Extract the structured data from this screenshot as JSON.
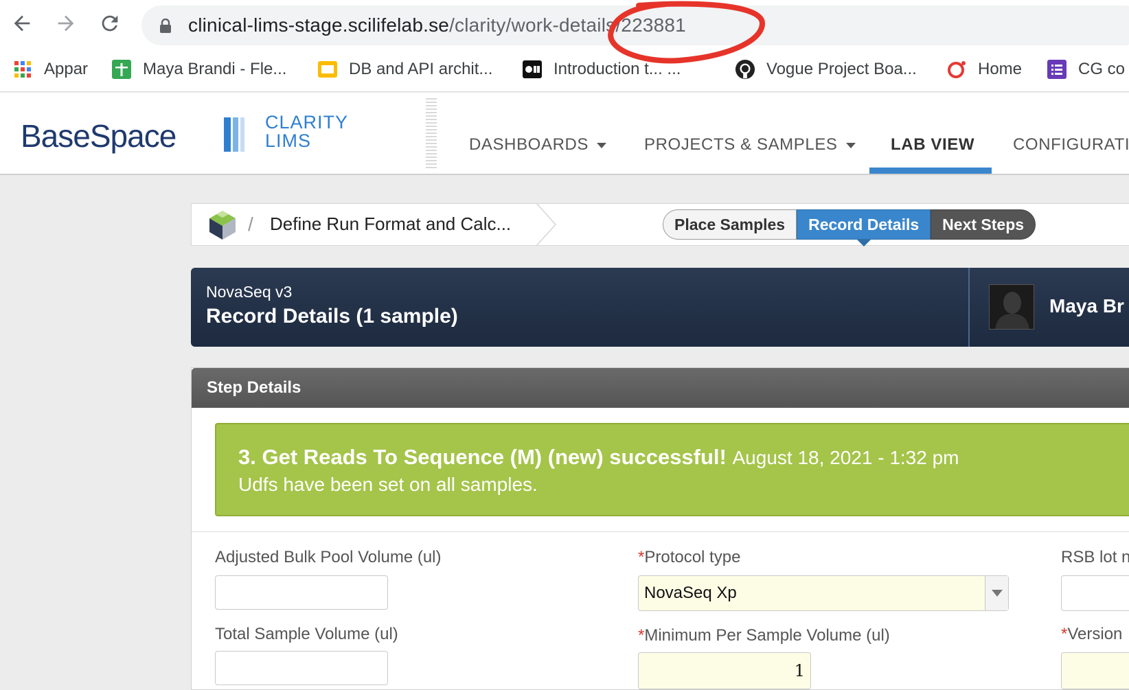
{
  "browser": {
    "url_host": "clinical-lims-stage.scilifelab.se",
    "url_path": "/clarity/work-details/223881",
    "bookmarks": [
      {
        "label": "Appar",
        "icon": "apps-grid-icon"
      },
      {
        "label": "Maya Brandi - Fle...",
        "icon": "google-sheets-icon"
      },
      {
        "label": "DB and API archit...",
        "icon": "google-slides-icon"
      },
      {
        "label": "Introduction t... ...",
        "icon": "video-icon"
      },
      {
        "label": "Vogue Project Boa...",
        "icon": "github-icon"
      },
      {
        "label": "Home",
        "icon": "opera-icon"
      },
      {
        "label": "CG co",
        "icon": "list-icon"
      }
    ]
  },
  "app": {
    "logo_base": "BaseSpace",
    "logo_clarity_line1": "CLARITY",
    "logo_clarity_line2": "LIMS",
    "nav": {
      "dashboards": "DASHBOARDS",
      "projects": "PROJECTS & SAMPLES",
      "lab_view": "LAB VIEW",
      "configuration": "CONFIGURATIO"
    }
  },
  "breadcrumb": {
    "separator": "/",
    "step_name": "Define Run Format and Calc..."
  },
  "steps": {
    "place": "Place Samples",
    "record": "Record Details",
    "next": "Next Steps"
  },
  "banner": {
    "protocol": "NovaSeq v3",
    "title": "Record Details (1 sample)",
    "user": "Maya Br"
  },
  "panel": {
    "header": "Step Details",
    "success_title": "3. Get Reads To Sequence (M) (new) successful!",
    "success_date": "August 18, 2021 - 1:32 pm",
    "success_message": "Udfs have been set on all samples."
  },
  "fields": {
    "adjusted_bulk_label": "Adjusted Bulk Pool Volume (ul)",
    "adjusted_bulk_value": "",
    "total_sample_label": "Total Sample Volume (ul)",
    "total_sample_value": "",
    "protocol_type_label": "Protocol type",
    "protocol_type_value": "NovaSeq Xp",
    "min_per_sample_label": "Minimum Per Sample Volume (ul)",
    "min_per_sample_value": "1",
    "rsb_lot_label": "RSB lot n",
    "version_label": "Version"
  },
  "colors": {
    "accent": "#3a86cc",
    "success": "#a5c44a",
    "banner": "#1d2a3f",
    "required": "#d9382b"
  }
}
